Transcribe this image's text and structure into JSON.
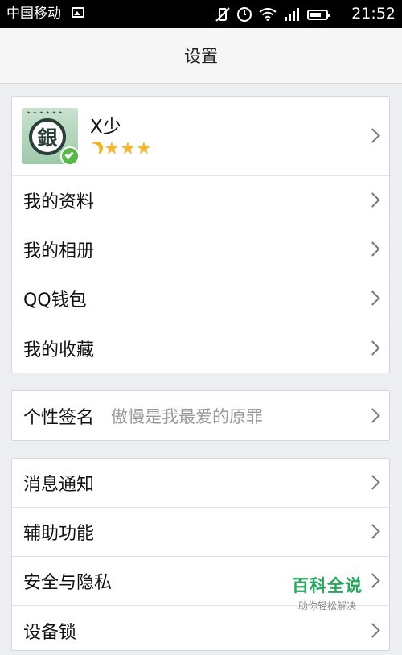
{
  "status_bar": {
    "carrier": "中国移动",
    "time": "21:52",
    "icons": [
      "image-icon",
      "vibrate-off-icon",
      "alarm-icon",
      "wifi-icon",
      "signal-icon",
      "battery-icon"
    ]
  },
  "header": {
    "title": "设置"
  },
  "profile": {
    "avatar_text": "銀",
    "nickname": "X少",
    "level": {
      "moons": 1,
      "stars": 3
    }
  },
  "group1": {
    "items": [
      {
        "label": "我的资料"
      },
      {
        "label": "我的相册"
      },
      {
        "label": "QQ钱包"
      },
      {
        "label": "我的收藏"
      }
    ]
  },
  "signature": {
    "label": "个性签名",
    "value": "傲慢是我最爱的原罪"
  },
  "group3": {
    "items": [
      {
        "label": "消息通知"
      },
      {
        "label": "辅助功能"
      },
      {
        "label": "安全与隐私"
      },
      {
        "label": "设备锁"
      }
    ]
  },
  "watermark": {
    "title": "百科全说",
    "subtitle": "助你轻松解决"
  },
  "colors": {
    "accent": "#26a65b",
    "badge": "#5ab84a",
    "star": "#f4b82a"
  }
}
